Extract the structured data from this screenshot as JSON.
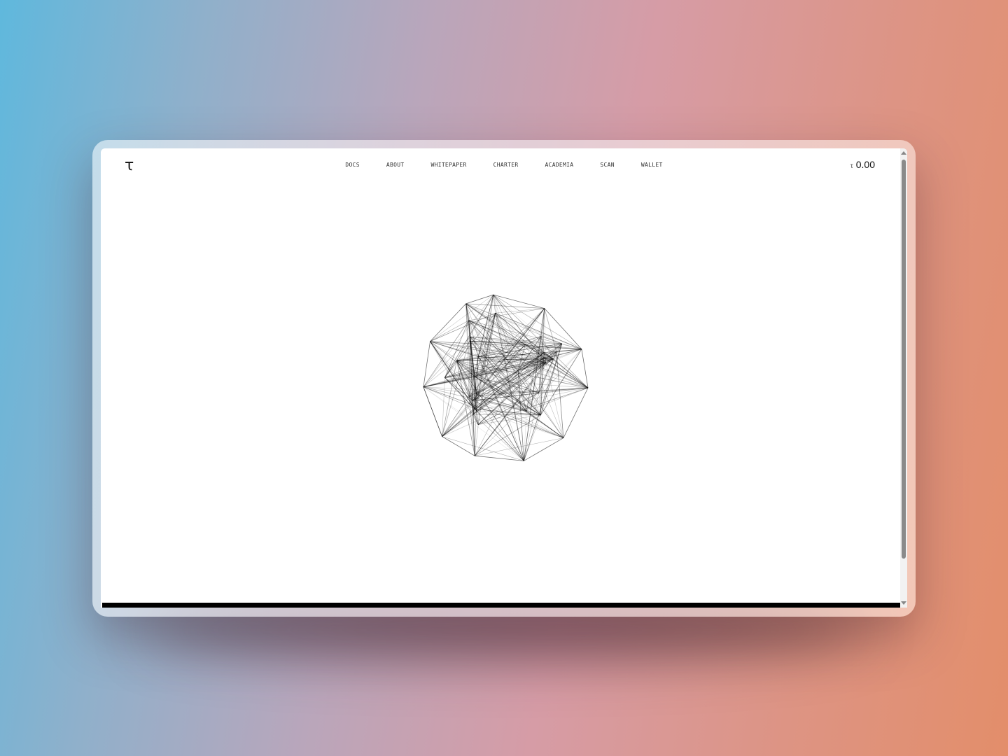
{
  "brand": {
    "logo_glyph": "τ"
  },
  "nav": {
    "items": [
      {
        "label": "DOCS"
      },
      {
        "label": "ABOUT"
      },
      {
        "label": "WHITEPAPER"
      },
      {
        "label": "CHARTER"
      },
      {
        "label": "ACADEMIA"
      },
      {
        "label": "SCAN"
      },
      {
        "label": "WALLET"
      }
    ]
  },
  "balance": {
    "symbol": "τ",
    "amount": "0.00"
  },
  "hero": {
    "graphic": "network-sphere-graphic"
  },
  "colors": {
    "text": "#111111",
    "background": "#ffffff",
    "accent_bar": "#000000"
  }
}
